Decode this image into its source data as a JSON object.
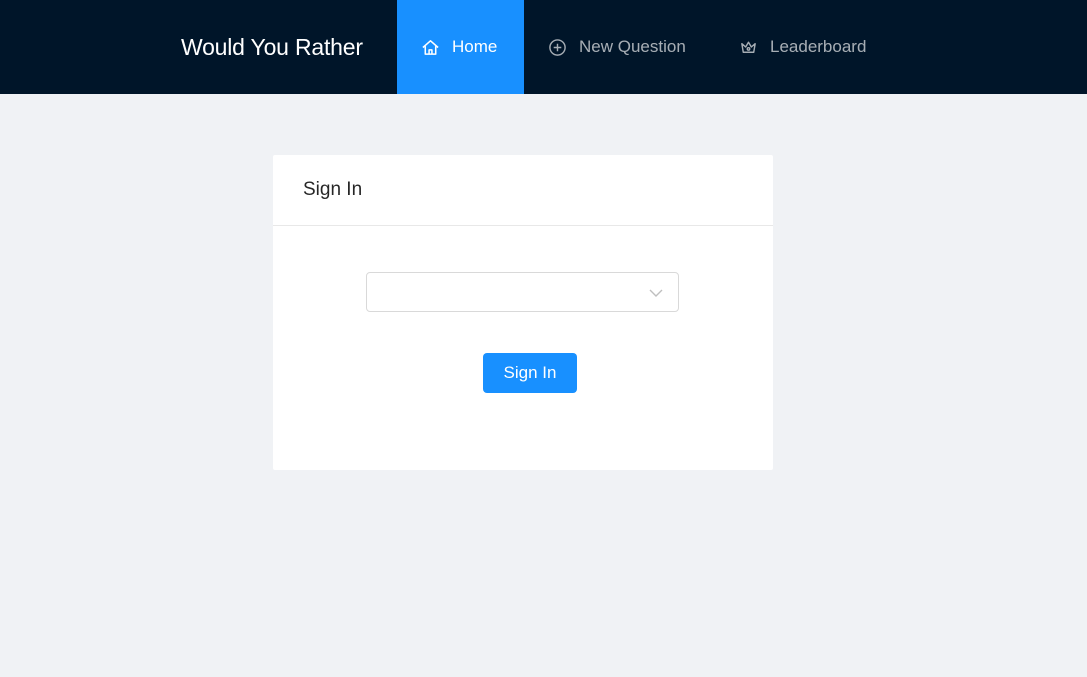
{
  "header": {
    "brand": "Would You Rather",
    "nav": [
      {
        "label": "Home",
        "icon": "home-icon",
        "active": true
      },
      {
        "label": "New Question",
        "icon": "plus-circle-icon",
        "active": false
      },
      {
        "label": "Leaderboard",
        "icon": "crown-icon",
        "active": false
      }
    ]
  },
  "signin": {
    "title": "Sign In",
    "select_value": "",
    "button_label": "Sign In"
  },
  "colors": {
    "header_bg": "#001529",
    "accent": "#1890ff",
    "page_bg": "#f0f2f5"
  }
}
